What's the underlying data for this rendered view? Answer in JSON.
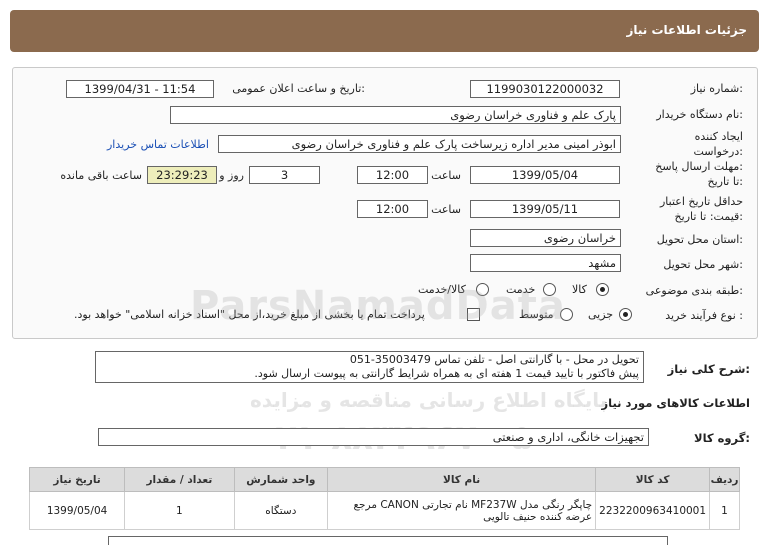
{
  "header": {
    "title": "جزئیات اطلاعات نیاز"
  },
  "form": {
    "need_number_label": "شماره نیاز:",
    "need_number": "1199030122000032",
    "announce_label": "تاریخ و ساعت اعلان عمومی:",
    "announce_value": "1399/04/31 - 11:54",
    "buyer_org_label": "نام دستگاه خریدار:",
    "buyer_org": "پارک علم و فناوری خراسان رضوی",
    "creator_label_1": "ایجاد کننده",
    "creator_label_2": "درخواست:",
    "creator": "ابوذر امینی مدیر اداره زیرساخت پارک علم و فناوری خراسان رضوی",
    "contact_link": "اطلاعات تماس خریدار",
    "deadline_label_1": "مهلت ارسال پاسخ:",
    "deadline_label_2": "تا تاریخ:",
    "deadline_date": "1399/05/04",
    "time_label": "ساعت",
    "deadline_time": "12:00",
    "days_value": "3",
    "days_label": "روز و",
    "remaining_time": "23:29:23",
    "remaining_label": "ساعت باقی مانده",
    "validity_label_1": "حداقل تاریخ اعتبار",
    "validity_label_2": "قیمت: تا تاریخ:",
    "validity_date": "1399/05/11",
    "validity_time_label": "ساعت",
    "validity_time": "12:00",
    "province_label": "استان محل تحویل:",
    "province": "خراسان رضوی",
    "city_label": "شهر محل تحویل:",
    "city": "مشهد",
    "category_label": "طبقه بندی موضوعی:",
    "category_options": [
      "کالا",
      "خدمت",
      "کالا/خدمت"
    ],
    "category_selected": "کالا",
    "process_label": "نوع فرآیند خرید :",
    "process_options": [
      "جزیی",
      "متوسط"
    ],
    "process_selected": "جزیی",
    "payment_note": "پرداخت تمام یا بخشی از مبلغ خرید،از محل \"اسناد خزانه اسلامی\" خواهد بود."
  },
  "description": {
    "label": "شرح کلی نیاز:",
    "line1": "تحویل در محل - با گارانتی اصل - تلفن تماس 35003479-051",
    "line2": "پیش فاکتور با تایید قیمت 1 هفته ای به همراه شرایط گارانتی به پیوست ارسال شود."
  },
  "goods": {
    "section_title": "اطلاعات کالاهای مورد نیاز",
    "group_label": "گروه کالا:",
    "group_value": "تجهیزات خانگی، اداری و صنعتی",
    "columns": [
      "ردیف",
      "کد کالا",
      "نام کالا",
      "واحد شمارش",
      "تعداد / مقدار",
      "تاریخ نیاز"
    ],
    "rows": [
      {
        "row": "1",
        "code": "2232200963410001",
        "name": "چاپگر رنگی مدل MF237W نام تجارتی CANON مرجع عرضه کننده حنیف تالویی",
        "unit": "دستگاه",
        "qty": "1",
        "date": "1399/05/04"
      }
    ]
  },
  "watermark": {
    "brand": "ParsNamadData",
    "line1": "پایگاه اطلاع رسانی مناقصه و مزایده",
    "phone": "۰۲۱-۸۸۳۴۹۶۷۰-۵"
  }
}
